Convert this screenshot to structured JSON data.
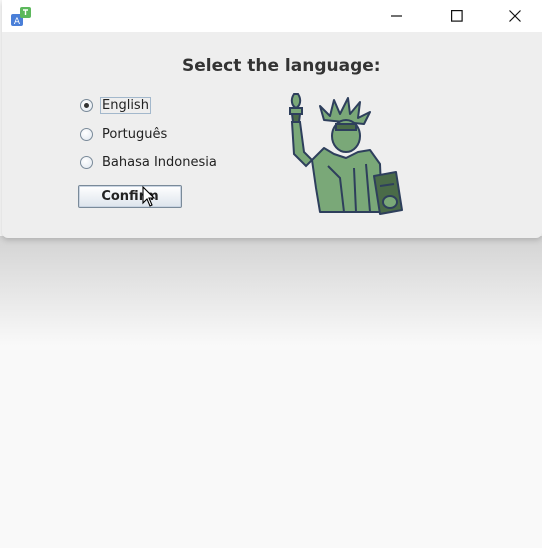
{
  "window": {
    "controls": {
      "minimize": "minimize-icon",
      "maximize": "maximize-icon",
      "close": "close-icon"
    }
  },
  "dialog": {
    "heading": "Select the language:",
    "languages": [
      {
        "label": "English",
        "selected": true
      },
      {
        "label": "Português",
        "selected": false
      },
      {
        "label": "Bahasa Indonesia",
        "selected": false
      }
    ],
    "confirm_label": "Confirm"
  },
  "illustration": {
    "icon": "statue-of-liberty-icon",
    "colors": {
      "fill": "#7aa878",
      "outline": "#2e3f5c",
      "dark": "#4a6b48"
    }
  }
}
